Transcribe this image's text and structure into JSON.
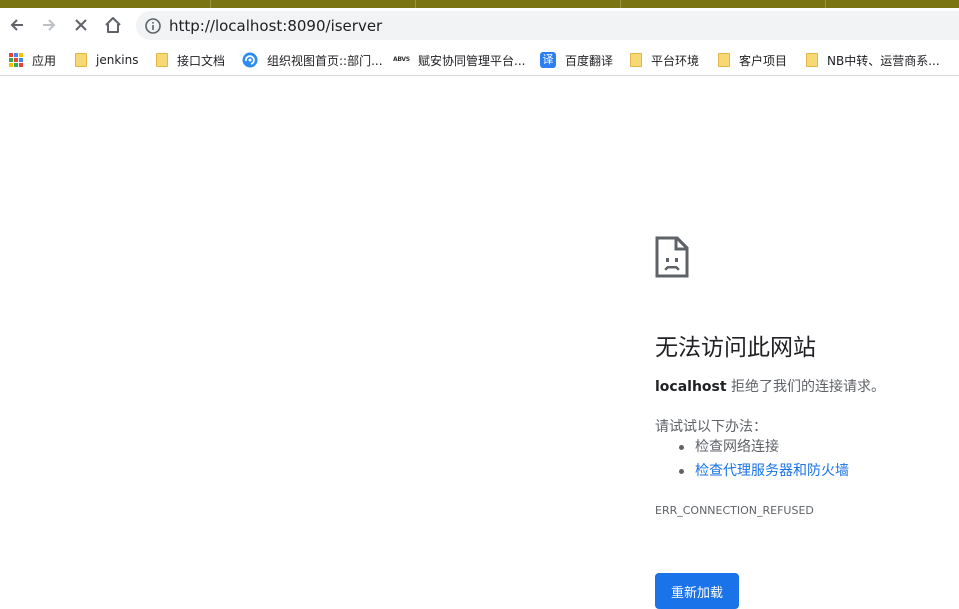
{
  "browser": {
    "url": "http://localhost:8090/iserver",
    "icons": {
      "back": "back-arrow-icon",
      "forward": "forward-arrow-icon",
      "stop": "stop-loading-icon",
      "home": "home-icon",
      "info": "info-icon"
    }
  },
  "bookmarks": {
    "items": [
      {
        "label": "应用",
        "icon": "apps-grid-icon"
      },
      {
        "label": "jenkins",
        "icon": "folder-icon"
      },
      {
        "label": "接口文档",
        "icon": "folder-icon"
      },
      {
        "label": "组织视图首页::部门...",
        "icon": "site-swirl-icon"
      },
      {
        "label": "赋安协同管理平台...",
        "icon": "abvs-logo-icon"
      },
      {
        "label": "百度翻译",
        "icon": "translate-icon"
      },
      {
        "label": "平台环境",
        "icon": "folder-icon"
      },
      {
        "label": "客户项目",
        "icon": "folder-icon"
      },
      {
        "label": "NB中转、运营商系...",
        "icon": "folder-icon"
      }
    ],
    "abvs_text": "ABVS",
    "translate_glyph": "译"
  },
  "error_page": {
    "icon": "sad-page-icon",
    "title": "无法访问此网站",
    "host": "localhost",
    "message": " 拒绝了我们的连接请求。",
    "try_label": "请试试以下办法：",
    "suggestions": [
      "检查网络连接",
      "检查代理服务器和防火墙"
    ],
    "error_code": "ERR_CONNECTION_REFUSED",
    "reload_label": "重新加载"
  },
  "colors": {
    "accent": "#1a73e8",
    "top_strip": "#7a7412",
    "folder": "#f8d775"
  }
}
